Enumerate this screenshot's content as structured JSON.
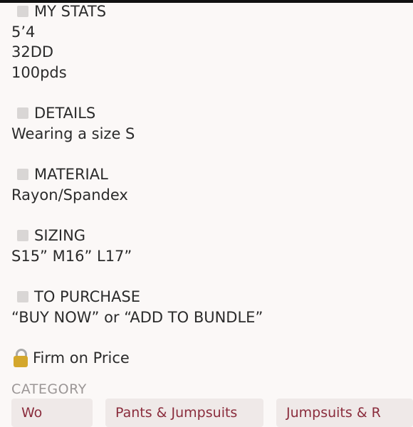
{
  "sections": {
    "stats": {
      "heading": "MY STATS",
      "lines": [
        "5’4",
        "32DD",
        "100pds"
      ]
    },
    "details": {
      "heading": "DETAILS",
      "text": "Wearing a size S"
    },
    "material": {
      "heading": "MATERIAL",
      "text": "Rayon/Spandex"
    },
    "sizing": {
      "heading": "SIZING",
      "text": "S15” M16” L17”"
    },
    "purchase": {
      "heading": "TO PURCHASE",
      "text": "“BUY NOW” or “ADD TO BUNDLE”"
    }
  },
  "price_note": "Firm on Price",
  "category": {
    "label": "CATEGORY",
    "chips": [
      "Wo",
      "Pants & Jumpsuits",
      "Jumpsuits & R"
    ]
  },
  "colors": {
    "accent": "#8a2c3c",
    "background": "#fbf8f7",
    "chip_bg": "#efe9e8",
    "muted": "#9b9696"
  }
}
